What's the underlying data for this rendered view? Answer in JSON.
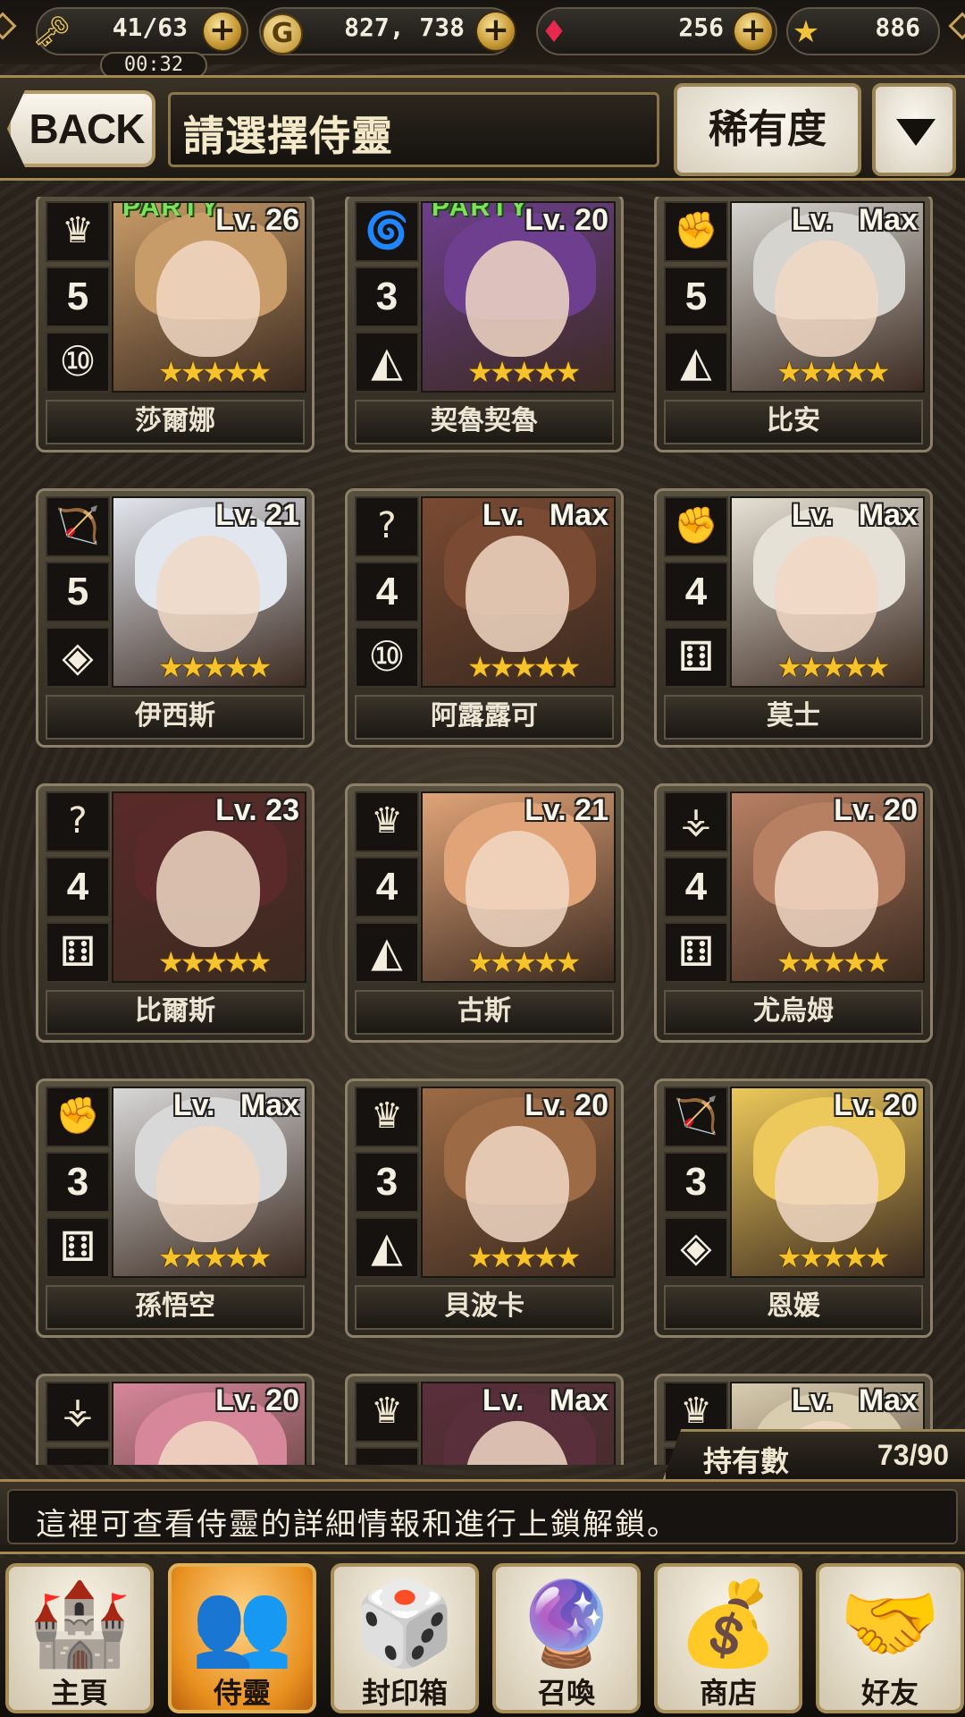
{
  "status_bar": {
    "stamina": "41/63",
    "timer": "00:32",
    "gold": "827, 738",
    "gems": "256",
    "medals": "886"
  },
  "header": {
    "back_label": "BACK",
    "title": "請選擇侍靈",
    "sort_label": "稀有度"
  },
  "cards": [
    {
      "name": "莎爾娜",
      "level": "Lv. 26",
      "cost": "5",
      "type_icon": "crown-icon",
      "type_glyph": "♛",
      "dice_glyph": "⑩",
      "dice_icon": "d10-icon",
      "stars": "★★★★★",
      "party": "PARTY",
      "hair": "#c89c68"
    },
    {
      "name": "契魯契魯",
      "level": "Lv. 20",
      "cost": "3",
      "type_icon": "tornado-icon",
      "type_glyph": "🌀",
      "dice_glyph": "◭",
      "dice_icon": "d4-icon",
      "stars": "★★★★★",
      "party": "PARTY",
      "hair": "#6d3f8e"
    },
    {
      "name": "比安",
      "level": "Lv.   Max",
      "cost": "5",
      "type_icon": "fist-icon",
      "type_glyph": "✊",
      "dice_glyph": "◭",
      "dice_icon": "d4-icon",
      "stars": "★★★★★",
      "party": "",
      "hair": "#d6d4cf"
    },
    {
      "name": "伊西斯",
      "level": "Lv. 21",
      "cost": "5",
      "type_icon": "bow-icon",
      "type_glyph": "🏹",
      "dice_glyph": "◈",
      "dice_icon": "d8-icon",
      "stars": "★★★★★",
      "party": "",
      "hair": "#e2e6ee"
    },
    {
      "name": "阿露露可",
      "level": "Lv.   Max",
      "cost": "4",
      "type_icon": "mask-icon",
      "type_glyph": "?",
      "dice_glyph": "⑩",
      "dice_icon": "d10-icon",
      "stars": "★★★★★",
      "party": "",
      "hair": "#7a4a32"
    },
    {
      "name": "莫士",
      "level": "Lv.   Max",
      "cost": "4",
      "type_icon": "fist-icon",
      "type_glyph": "✊",
      "dice_glyph": "⚅",
      "dice_icon": "d6-icon",
      "stars": "★★★★★",
      "party": "",
      "hair": "#e6e1d6"
    },
    {
      "name": "比爾斯",
      "level": "Lv. 23",
      "cost": "4",
      "type_icon": "mask-icon",
      "type_glyph": "?",
      "dice_glyph": "⚅",
      "dice_icon": "d6-icon",
      "stars": "★★★★★",
      "party": "",
      "hair": "#5a2a2a"
    },
    {
      "name": "古斯",
      "level": "Lv. 21",
      "cost": "4",
      "type_icon": "crown-icon",
      "type_glyph": "♛",
      "dice_glyph": "◭",
      "dice_icon": "d4-icon",
      "stars": "★★★★★",
      "party": "",
      "hair": "#e0a478"
    },
    {
      "name": "尤烏姆",
      "level": "Lv. 20",
      "cost": "4",
      "type_icon": "spear-icon",
      "type_glyph": "⚶",
      "dice_glyph": "⚅",
      "dice_icon": "d6-icon",
      "stars": "★★★★★",
      "party": "",
      "hair": "#b88063"
    },
    {
      "name": "孫悟空",
      "level": "Lv.   Max",
      "cost": "3",
      "type_icon": "fist-icon",
      "type_glyph": "✊",
      "dice_glyph": "⚅",
      "dice_icon": "d6-icon",
      "stars": "★★★★★",
      "party": "",
      "hair": "#d8d8d8"
    },
    {
      "name": "貝波卡",
      "level": "Lv. 20",
      "cost": "3",
      "type_icon": "crown-icon",
      "type_glyph": "♛",
      "dice_glyph": "◭",
      "dice_icon": "d4-icon",
      "stars": "★★★★★",
      "party": "",
      "hair": "#9c6b45"
    },
    {
      "name": "恩媛",
      "level": "Lv. 20",
      "cost": "3",
      "type_icon": "bow-icon",
      "type_glyph": "🏹",
      "dice_glyph": "◈",
      "dice_icon": "d8-icon",
      "stars": "★★★★★",
      "party": "",
      "hair": "#ecc95a"
    },
    {
      "name": "",
      "level": "Lv. 20",
      "cost": "",
      "type_icon": "spear-icon",
      "type_glyph": "⚶",
      "dice_glyph": "",
      "dice_icon": "",
      "stars": "",
      "party": "",
      "hair": "#d7879a"
    },
    {
      "name": "",
      "level": "Lv.   Max",
      "cost": "",
      "type_icon": "crown-icon",
      "type_glyph": "♛",
      "dice_glyph": "",
      "dice_icon": "",
      "stars": "",
      "party": "",
      "hair": "#5a2f3c"
    },
    {
      "name": "",
      "level": "Lv.   Max",
      "cost": "",
      "type_icon": "crown-icon",
      "type_glyph": "♛",
      "dice_glyph": "",
      "dice_icon": "",
      "stars": "",
      "party": "",
      "hair": "#d9cdb0"
    }
  ],
  "count": {
    "label": "持有數",
    "value": "73/90"
  },
  "info": {
    "text": "這裡可查看侍靈的詳細情報和進行上鎖解鎖。"
  },
  "nav": [
    {
      "label": "主頁",
      "icon": "castle-icon",
      "glyph": "🏰",
      "active": false
    },
    {
      "label": "侍靈",
      "icon": "spirits-icon",
      "glyph": "👥",
      "active": true
    },
    {
      "label": "封印箱",
      "icon": "seal-box-icon",
      "glyph": "🎲",
      "active": false
    },
    {
      "label": "召喚",
      "icon": "summon-icon",
      "glyph": "🔮",
      "active": false
    },
    {
      "label": "商店",
      "icon": "shop-icon",
      "glyph": "💰",
      "active": false
    },
    {
      "label": "好友",
      "icon": "handshake-icon",
      "glyph": "🤝",
      "active": false
    }
  ],
  "colors": {
    "accent_gold": "#a5884e",
    "active_tab": "#e8901f",
    "star": "#f6c42a",
    "party_green": "#7de15c"
  }
}
